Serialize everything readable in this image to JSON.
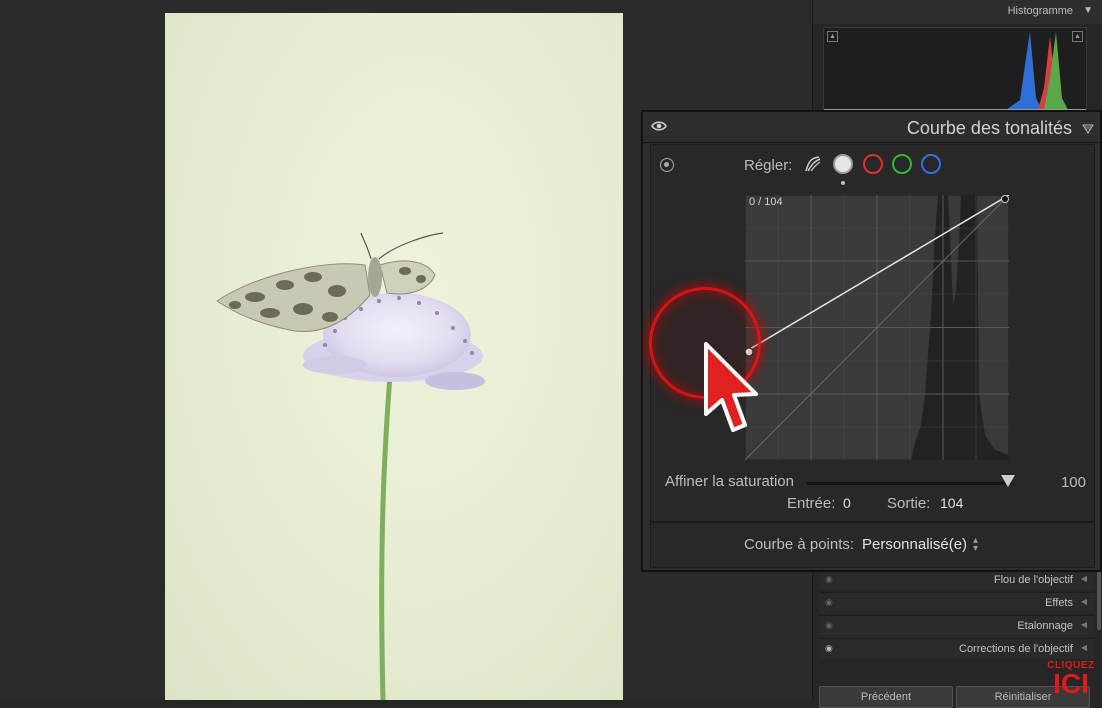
{
  "histogram": {
    "title": "Histogramme",
    "toggle_icon": "triangle-down-icon"
  },
  "tone_curve": {
    "title": "Courbe des tonalités",
    "adjust_label": "Régler:",
    "channels": [
      "parametric-curve-icon",
      "point-curve-white",
      "red-channel",
      "green-channel",
      "blue-channel"
    ],
    "coordinate_readout": "0 / 104",
    "saturation_label": "Affiner la saturation",
    "saturation_value": "100",
    "input_label": "Entrée:",
    "input_value": "0",
    "output_label": "Sortie:",
    "output_value": "104",
    "point_curve_label": "Courbe à points:",
    "point_curve_value": "Personnalisé(e)",
    "curve_points": [
      [
        0,
        104
      ],
      [
        255,
        255
      ]
    ]
  },
  "sections": [
    {
      "label": "Flou de l'objectif"
    },
    {
      "label": "Effets"
    },
    {
      "label": "Etalonnage"
    },
    {
      "label": "Corrections de l'objectif"
    }
  ],
  "footer": {
    "previous_label": "Précédent",
    "reset_label": "Réinitialiser"
  },
  "promo": {
    "top": "CLIQUEZ",
    "big": "ICI"
  },
  "colors": {
    "red": "#e03030",
    "green": "#35b535",
    "blue": "#3570e0",
    "accent_red": "#e01919"
  }
}
